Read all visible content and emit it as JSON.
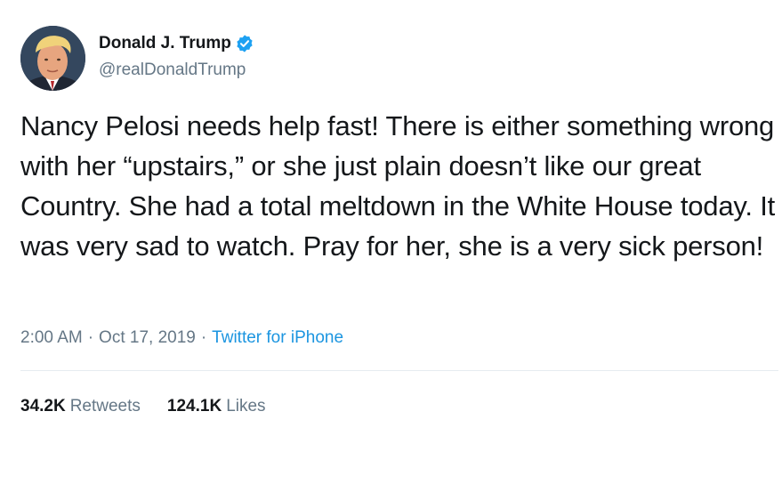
{
  "author": {
    "display_name": "Donald J. Trump",
    "handle": "@realDonaldTrump",
    "verified": true,
    "verified_color": "#1da1f2"
  },
  "tweet": {
    "text": "Nancy Pelosi needs help fast! There is either something wrong with her “upstairs,” or she just plain doesn’t like our great Country. She had a total meltdown in the White House today. It was very sad to watch. Pray for her, she is a very sick person!"
  },
  "meta": {
    "time": "2:00 AM",
    "separator": "·",
    "date": "Oct 17, 2019",
    "source": "Twitter for iPhone"
  },
  "stats": {
    "retweets_count": "34.2K",
    "retweets_label": "Retweets",
    "likes_count": "124.1K",
    "likes_label": "Likes"
  },
  "colors": {
    "text": "#14171a",
    "secondary": "#657786",
    "link": "#1b95e0",
    "divider": "#e6ecf0"
  }
}
